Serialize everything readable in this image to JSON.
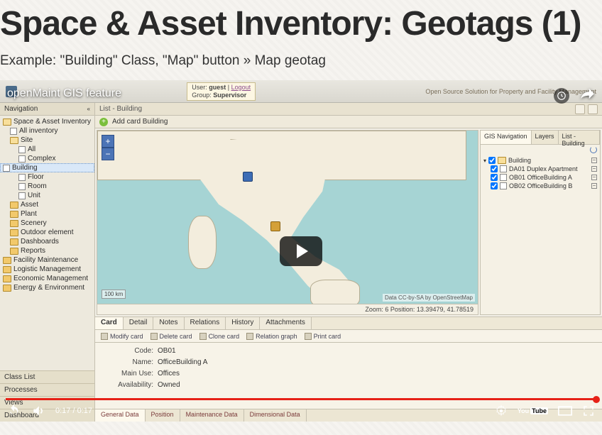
{
  "page": {
    "title": "Space & Asset Inventory: Geotags (1)",
    "subtitle": "Example: \"Building\" Class, \"Map\" button » Map geotag"
  },
  "video": {
    "title": "openMaint GIS feature",
    "current_time": "0:17",
    "duration": "0:17",
    "time_display": "0:17 / 0:17"
  },
  "app": {
    "user": {
      "label": "User",
      "name": "guest",
      "logout": "Logout"
    },
    "group": {
      "label": "Group",
      "name": "Supervisor"
    },
    "tagline": "Open Source Solution for Property and Facility Management",
    "nav_header": "Navigation",
    "nav_tree": [
      {
        "label": "Space & Asset Inventory",
        "icon": "folder-open",
        "indent": 0
      },
      {
        "label": "All inventory",
        "icon": "page",
        "indent": 1
      },
      {
        "label": "Site",
        "icon": "folder-open",
        "indent": 1
      },
      {
        "label": "All",
        "icon": "page",
        "indent": 2
      },
      {
        "label": "Complex",
        "icon": "page",
        "indent": 2
      },
      {
        "label": "Building",
        "icon": "page",
        "indent": 2,
        "selected": true
      },
      {
        "label": "Floor",
        "icon": "page",
        "indent": 2
      },
      {
        "label": "Room",
        "icon": "page",
        "indent": 2
      },
      {
        "label": "Unit",
        "icon": "page",
        "indent": 2
      },
      {
        "label": "Asset",
        "icon": "folder",
        "indent": 1
      },
      {
        "label": "Plant",
        "icon": "folder",
        "indent": 1
      },
      {
        "label": "Scenery",
        "icon": "folder",
        "indent": 1
      },
      {
        "label": "Outdoor element",
        "icon": "folder",
        "indent": 1
      },
      {
        "label": "Dashboards",
        "icon": "folder",
        "indent": 1
      },
      {
        "label": "Reports",
        "icon": "folder",
        "indent": 1
      },
      {
        "label": "Facility Maintenance",
        "icon": "folder",
        "indent": 0
      },
      {
        "label": "Logistic Management",
        "icon": "folder",
        "indent": 0
      },
      {
        "label": "Economic Management",
        "icon": "folder",
        "indent": 0
      },
      {
        "label": "Energy & Environment",
        "icon": "folder",
        "indent": 0
      }
    ],
    "accordion": [
      "Class List",
      "Processes",
      "Views",
      "Dashboard"
    ],
    "content_title": "List - Building",
    "add_card": "Add card Building",
    "map": {
      "scale": "100 km",
      "attribution": "Data CC-by-SA by OpenStreetMap",
      "position": "Zoom: 6 Position: 13.39479, 41.78519"
    },
    "gis": {
      "tabs": [
        "GIS Navigation",
        "Layers",
        "List - Building"
      ],
      "active_tab": 0,
      "tree": {
        "root": "Building",
        "children": [
          "DA01 Duplex Apartment",
          "OB01 OfficeBuilding A",
          "OB02 OfficeBuilding B"
        ]
      }
    },
    "card": {
      "tabs": [
        "Card",
        "Detail",
        "Notes",
        "Relations",
        "History",
        "Attachments"
      ],
      "active_tab": 0,
      "toolbar": [
        "Modify card",
        "Delete card",
        "Clone card",
        "Relation graph",
        "Print card"
      ],
      "fields": [
        {
          "label": "Code:",
          "value": "OB01"
        },
        {
          "label": "Name:",
          "value": "OfficeBuilding A"
        },
        {
          "label": "Main Use:",
          "value": "Offices"
        },
        {
          "label": "Availability:",
          "value": "Owned"
        }
      ],
      "bottom_tabs": [
        "General Data",
        "Position",
        "Maintenance Data",
        "Dimensional Data"
      ],
      "active_bottom": 0
    }
  },
  "colors": {
    "accent": "#e62117",
    "sea": "#a6d4d4",
    "land": "#f3eddd"
  }
}
